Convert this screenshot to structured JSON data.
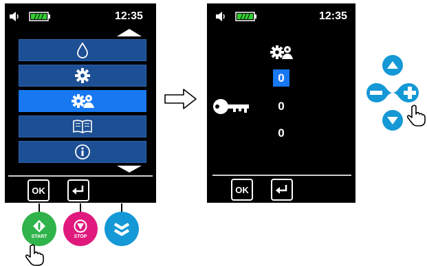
{
  "left_screen": {
    "time": "12:35",
    "menu_items": [
      {
        "icon": "droplet-icon"
      },
      {
        "icon": "gear-icon"
      },
      {
        "icon": "user-settings-icon",
        "selected": true
      },
      {
        "icon": "book-icon"
      },
      {
        "icon": "info-icon"
      }
    ],
    "ok_label": "OK"
  },
  "physical_buttons": {
    "start_label": "START",
    "stop_label": "STOP"
  },
  "right_screen": {
    "time": "12:35",
    "values": [
      "0",
      "0",
      "0"
    ],
    "selected_index": 0,
    "ok_label": "OK"
  },
  "colors": {
    "screen_bg": "#000000",
    "menu_item": "#1d4f94",
    "menu_selected": "#1778f2",
    "start_green": "#2fb34a",
    "stop_pink": "#e0197d",
    "scroll_blue": "#1598d6",
    "battery_green": "#33cc33"
  }
}
